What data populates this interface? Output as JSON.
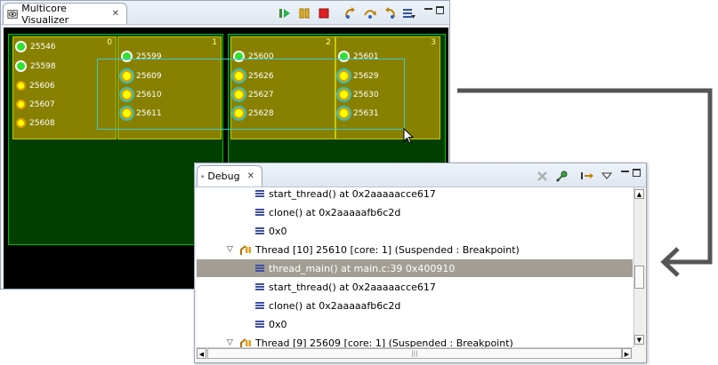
{
  "visualizer": {
    "tab_title": "Multicore Visualizer",
    "tab_icon": "visualizer-icon",
    "toolbar": [
      "resume-icon",
      "suspend-icon",
      "terminate-icon",
      "step-into-icon",
      "step-over-icon",
      "step-return-icon",
      "view-menu-icon"
    ],
    "cores": [
      {
        "number": "0",
        "threads": [
          {
            "id": "25546",
            "state": "running"
          },
          {
            "id": "25598",
            "state": "running"
          },
          {
            "id": "25606",
            "state": "suspended"
          },
          {
            "id": "25607",
            "state": "suspended"
          },
          {
            "id": "25608",
            "state": "suspended"
          }
        ]
      },
      {
        "number": "1",
        "threads": [
          {
            "id": "25599",
            "state": "running"
          },
          {
            "id": "25609",
            "state": "suspended"
          },
          {
            "id": "25610",
            "state": "suspended"
          },
          {
            "id": "25611",
            "state": "suspended"
          }
        ]
      },
      {
        "number": "2",
        "threads": [
          {
            "id": "25600",
            "state": "running"
          },
          {
            "id": "25626",
            "state": "suspended"
          },
          {
            "id": "25627",
            "state": "suspended"
          },
          {
            "id": "25628",
            "state": "suspended"
          }
        ]
      },
      {
        "number": "3",
        "threads": [
          {
            "id": "25601",
            "state": "running"
          },
          {
            "id": "25629",
            "state": "suspended"
          },
          {
            "id": "25630",
            "state": "suspended"
          },
          {
            "id": "25631",
            "state": "suspended"
          }
        ]
      }
    ],
    "colors": {
      "cpu_bg": "#003f00",
      "core_bg": "#888000",
      "running": "#30e030",
      "suspended": "#ffff00",
      "selection": "#40c8c8"
    }
  },
  "debug": {
    "tab_title": "Debug",
    "tab_icon": "debug-bug-icon",
    "toolbar": [
      "remove-terminated-icon",
      "connect-icon",
      "step-filters-icon",
      "view-menu-icon"
    ],
    "rows": [
      {
        "kind": "frame",
        "text": "start_thread() at 0x2aaaaacce617"
      },
      {
        "kind": "frame",
        "text": "clone() at 0x2aaaaafb6c2d"
      },
      {
        "kind": "frame",
        "text": "0x0"
      },
      {
        "kind": "thread",
        "text": "Thread [10] 25610 [core: 1] (Suspended : Breakpoint)"
      },
      {
        "kind": "frame",
        "text": "thread_main() at main.c:39 0x400910",
        "selected": true
      },
      {
        "kind": "frame",
        "text": "start_thread() at 0x2aaaaacce617"
      },
      {
        "kind": "frame",
        "text": "clone() at 0x2aaaaafb6c2d"
      },
      {
        "kind": "frame",
        "text": "0x0"
      },
      {
        "kind": "thread",
        "text": "Thread [9] 25609 [core: 1] (Suspended : Breakpoint)"
      }
    ]
  }
}
